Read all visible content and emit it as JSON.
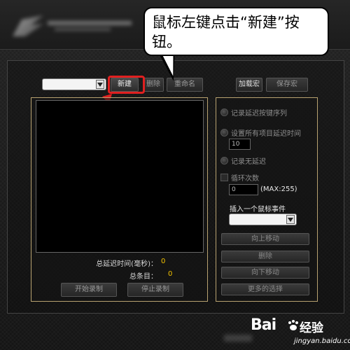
{
  "callout": {
    "line1": "鼠标左键点击“新建”按",
    "line2": "钮。"
  },
  "toolbar": {
    "new_label": "新建",
    "delete_label": "删除",
    "rename_label": "重命名",
    "load_macro_label": "加载宏",
    "save_macro_label": "保存宏"
  },
  "macro_dropdown": {
    "value": ""
  },
  "stats": {
    "total_delay_label": "总延迟时间(毫秒)：",
    "total_delay_value": "0",
    "total_items_label": "总条目：",
    "total_items_value": "0"
  },
  "record": {
    "start_label": "开始录制",
    "stop_label": "停止录制"
  },
  "options": {
    "record_delay_label": "记录延迟按键序列",
    "set_delay_label": "设置所有项目延迟时间",
    "set_delay_value": "10",
    "no_delay_label": "记录无延迟",
    "loop_label": "循环次数",
    "loop_value": "0",
    "loop_max_label": "(MAX:255)",
    "insert_mouse_label": "插入一个鼠标事件",
    "mouse_event_value": ""
  },
  "actions": {
    "move_up_label": "向上移动",
    "delete_label": "删除",
    "move_down_label": "向下移动",
    "more_options_label": "更多的选择"
  },
  "watermark": {
    "brand": "Bai",
    "brand_suffix": "经验",
    "url": "jingyan.baidu.com"
  },
  "colors": {
    "highlight": "#e02020",
    "panel_border": "#b8a270",
    "stat_value": "#f0c000"
  }
}
